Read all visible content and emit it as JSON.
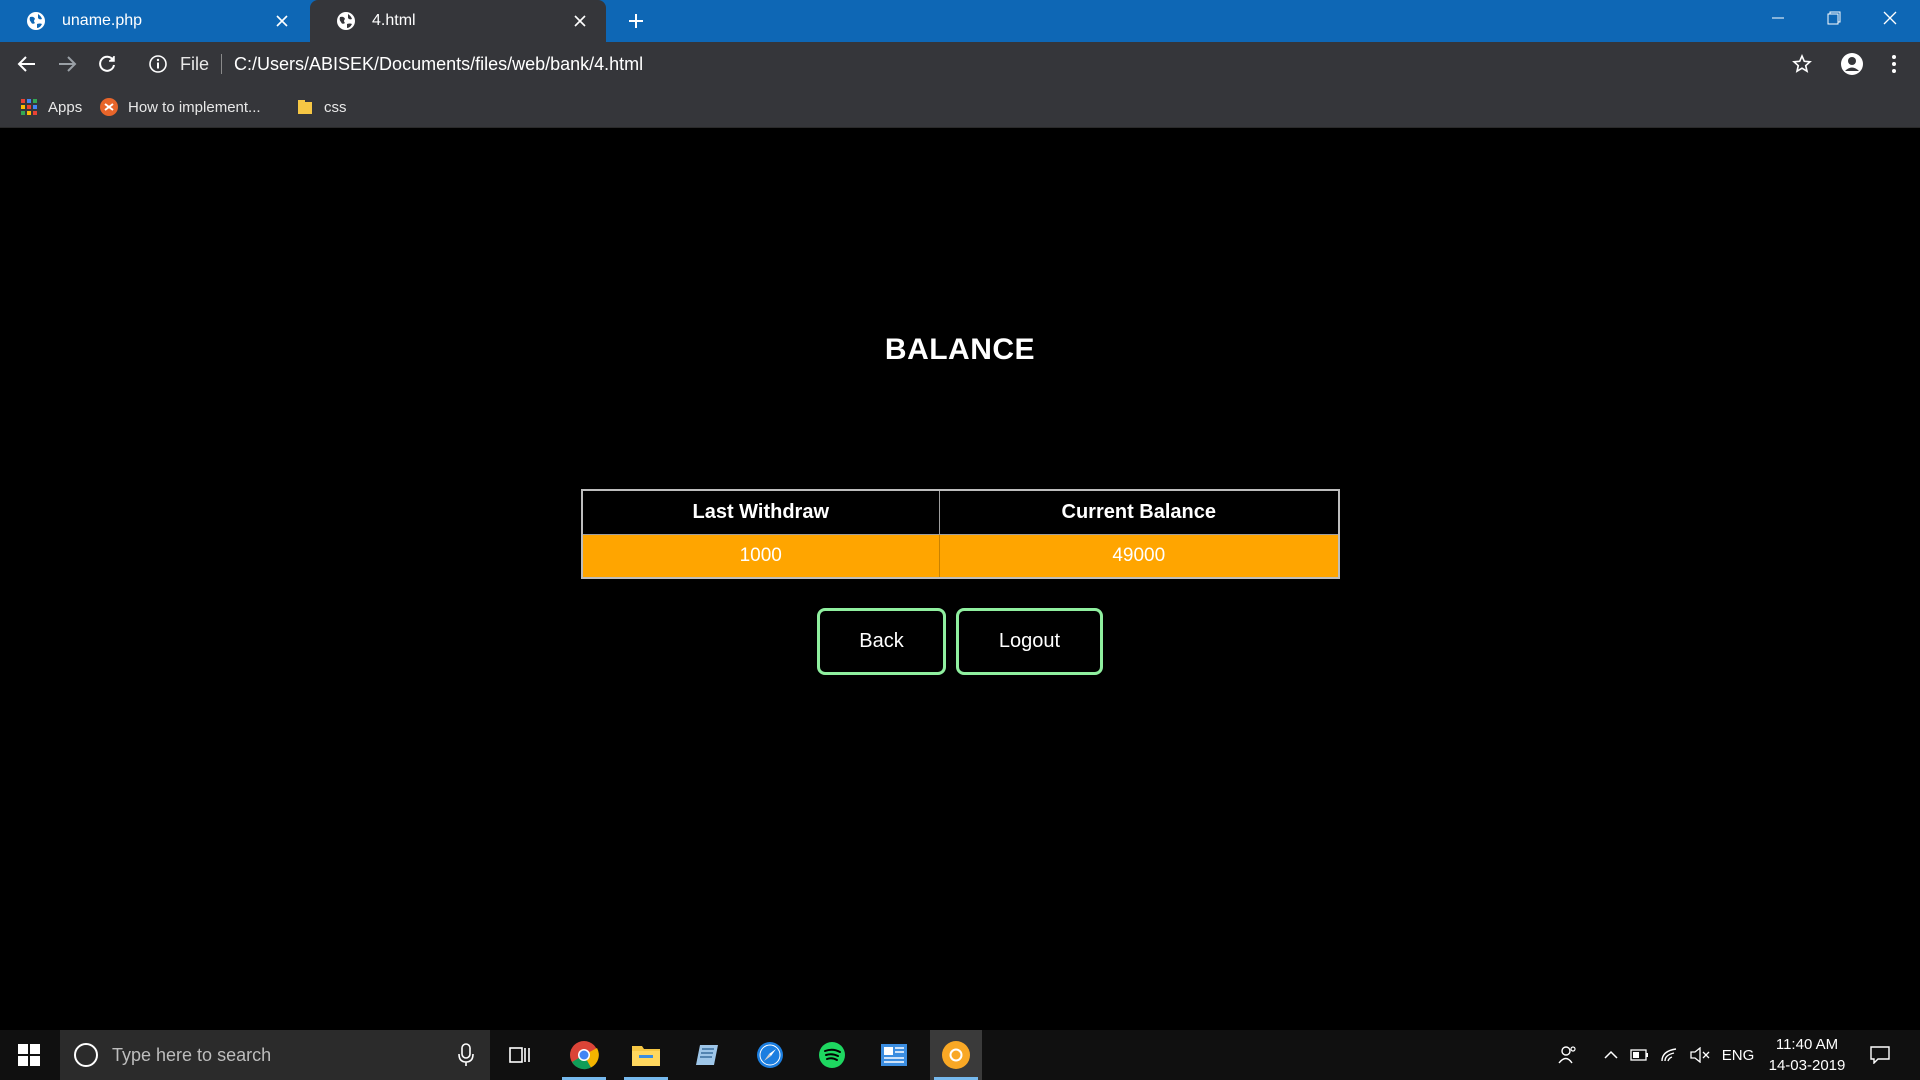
{
  "browser": {
    "tabs": [
      {
        "title": "uname.php",
        "active": false
      },
      {
        "title": "4.html",
        "active": true
      }
    ],
    "address": {
      "scheme_label": "File",
      "url": "C:/Users/ABISEK/Documents/files/web/bank/4.html"
    },
    "bookmarks": [
      {
        "label": "Apps",
        "icon": "apps-grid-icon"
      },
      {
        "label": "How to implement...",
        "icon": "stackoverflow-icon"
      },
      {
        "label": "css",
        "icon": "folder-icon"
      }
    ]
  },
  "page": {
    "title": "BALANCE",
    "table": {
      "headers": [
        "Last Withdraw",
        "Current Balance"
      ],
      "rows": [
        [
          "1000",
          "49000"
        ]
      ]
    },
    "buttons": {
      "back": "Back",
      "logout": "Logout"
    }
  },
  "taskbar": {
    "search_placeholder": "Type here to search",
    "apps": [
      "chrome-icon",
      "file-explorer-icon",
      "notepad-icon",
      "safari-icon",
      "spotify-icon",
      "outlook-icon",
      "chrome-canary-icon"
    ],
    "language": "ENG",
    "time": "11:40 AM",
    "date": "14-03-2019"
  },
  "colors": {
    "tabstrip": "#0e67b5",
    "toolbar": "#35363a",
    "table_row": "#ffa500",
    "button_border": "#8fef9f",
    "page_bg": "#000000"
  }
}
